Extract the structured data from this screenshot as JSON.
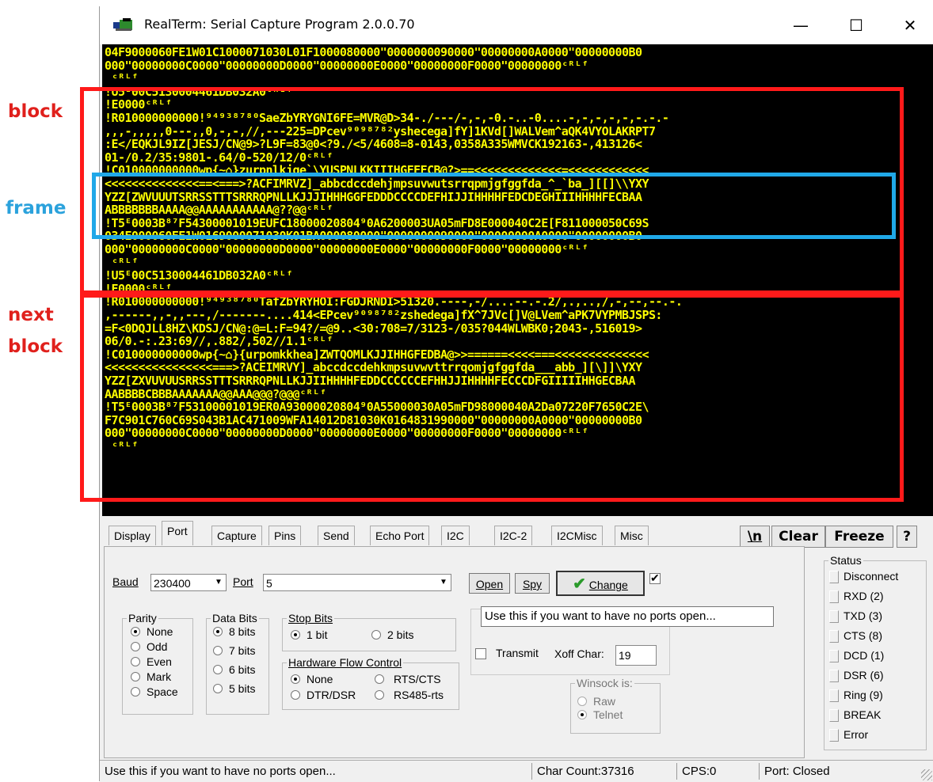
{
  "annotations": {
    "block": "block",
    "frame": "frame",
    "next_block": [
      "next",
      "block"
    ]
  },
  "window": {
    "title": "RealTerm: Serial Capture Program 2.0.0.70",
    "minimize": "—",
    "maximize": "☐",
    "close": "✕"
  },
  "terminal": {
    "lines": [
      "04F9000060FE1W01C1000071030L01F1000080000\"0000000090000\"00000000A0000\"00000000B0",
      "000\"00000000C0000\"00000000D0000\"00000000E0000\"00000000F0000\"00000000ᶜᴿᴸᶠ",
      " ᶜᴿᴸᶠ",
      "!U5ᴱ00C5130004461DB032A0ᶜᴿᴸᶠ",
      "!E0000ᶜᴿᴸᶠ",
      "!R010000000000!⁹⁴⁹³⁸⁷⁸⁰SaeZbYRYGNI6FE=MVR@D>34-./---/-,-,-0.-..-0....-,-,-,-,-,-.-.-",
      ",,,-,,,,,0---,,0,-,-,//,---225=DPcev⁹⁰⁹⁸⁷⁸²yshecega]fY]1KVd[]WALVem^aQK4VYOLAKRPT7",
      ":E</EQKJL9IZ[JESJ/CN@9>?L9F=83@0<?9./<5/4608=8-0143,0358A335WMVCK192163-,413126<",
      "01-/0.2/35:9801-.64/0-520/12/0ᶜᴿᴸᶠ",
      "!C010000000000wp{~⌂}zurpnlkjge`\\YUSPNLKKIIIHGFEECB@?>==<<<<<<<<<<<<<=<<<<<<<<<<<<",
      "<<<<<<<<<<<<<<==<===>?ACFIMRVZ]_abbcdccdehjmpsuvwutsrrqpmjgfggfda_^_`ba_][[]\\\\YXY",
      "YZZ[ZWVUUUTSRRSSTTTSRRRQPNLLKJJJIHHHGGFEDDDCCCCDEFHIJJIHHHHFEDCDEGHIIIHHHHFECBAA",
      "ABBBBBBBAAAA@@AAAAAAAAAAA@??@@ᶜᴿᴸᶠ",
      "!T5ᴱ0003B⁸⁷F54300001019EUFC18000020804⁹0A6200003UA05mFD8E000040C2E[F811000050C69S",
      "034E000060FE1W0169000071030K01BA000080000\"0000000090000\"00000000A0000\"00000000B0",
      "000\"00000000C0000\"00000000D0000\"00000000E0000\"00000000F0000\"00000000ᶜᴿᴸᶠ",
      " ᶜᴿᴸᶠ",
      "!U5ᴱ00C5130004461DB032A0ᶜᴿᴸᶠ",
      "!E0000ᶜᴿᴸᶠ",
      "!R010000000000!⁹⁴⁹³⁸⁷⁸⁰TafZbYRYHOI:FGDJRNDI>51320.----,-/....--.-.2/,.,..,/,-,--,--.-.",
      ",------,,-,,---,/-------....414<EPcev⁹⁰⁹⁸⁷⁸²zshedega]fX^7JVc[]V@LVem^aPK7VYPMBJSPS:",
      "=F<0DQJLL8HZ\\KDSJ/CN@:@=L:F=94?/=@9..<30:708=7/3123-/035?044WLWBK0;2043-,516019>",
      "06/0.-:.23:69//,.882/,502//1.1ᶜᴿᴸᶠ",
      "!C010000000000wp{~⌂}{urpomkkhea]ZWTQOMLKJJIHHGFEDBA@>>======<<<<===<<<<<<<<<<<<<<",
      "<<<<<<<<<<<<<<<<===>?ACEIMRVY]_abccdccdehkmpsuvwvttrrqomjgfggfda___abb_][\\]]\\YXY",
      "YZZ[ZXVUVUUSRRSSTTTSRRRQPNLLKJJIIHHHHFEDDCCCCCCEFHHJJIHHHHFECCCDFGIIIIIHHGECBAA",
      "AABBBBCBBBAAAAAAA@@AAA@@@?@@@ᶜᴿᴸᶠ",
      "!T5ᴱ0003B⁸⁷F53100001019ER0A93000020804⁹0A55000030A05mFD98000040A2Da07220F7650C2E\\",
      "F7C901C760C69S043B1AC471009WFA14012D81030K0164831990000\"00000000A0000\"00000000B0",
      "000\"00000000C0000\"00000000D0000\"00000000E0000\"00000000F0000\"00000000ᶜᴿᴸᶠ",
      " ᶜᴿᴸᶠ"
    ]
  },
  "tabs": [
    "Display",
    "Port",
    "Capture",
    "Pins",
    "Send",
    "Echo Port",
    "I2C",
    "I2C-2",
    "I2CMisc",
    "Misc"
  ],
  "toolbar": {
    "newline": "\\n",
    "clear": "Clear",
    "freeze": "Freeze",
    "help": "?"
  },
  "port": {
    "baud_label": "Baud",
    "baud_value": "230400",
    "port_label": "Port",
    "port_value": "5",
    "open": "Open",
    "spy": "Spy",
    "change": "Change",
    "parity": {
      "label": "Parity",
      "options": [
        "None",
        "Odd",
        "Even",
        "Mark",
        "Space"
      ]
    },
    "data_bits": {
      "label": "Data Bits",
      "options": [
        "8 bits",
        "7 bits",
        "6 bits",
        "5 bits"
      ]
    },
    "stop_bits": {
      "label": "Stop Bits",
      "options": [
        "1 bit",
        "2 bits"
      ]
    },
    "hw_flow": {
      "label": "Hardware Flow Control",
      "options": [
        "None",
        "RTS/CTS",
        "DTR/DSR",
        "RS485-rts"
      ]
    },
    "transmit": "Transmit",
    "xoff_label": "Xoff Char:",
    "xoff_value": "19",
    "winsock": {
      "label": "Winsock is:",
      "options": [
        "Raw",
        "Telnet"
      ]
    }
  },
  "tooltip": "Use this if you want to have no ports open...",
  "status": {
    "label": "Status",
    "items": [
      "Disconnect",
      "RXD (2)",
      "TXD (3)",
      "CTS (8)",
      "DCD (1)",
      "DSR (6)",
      "Ring (9)",
      "BREAK",
      "Error"
    ]
  },
  "statusbar": {
    "message": "Use this if you want to have no ports open...",
    "char_count": "Char Count:37316",
    "cps": "CPS:0",
    "port": "Port: Closed"
  }
}
